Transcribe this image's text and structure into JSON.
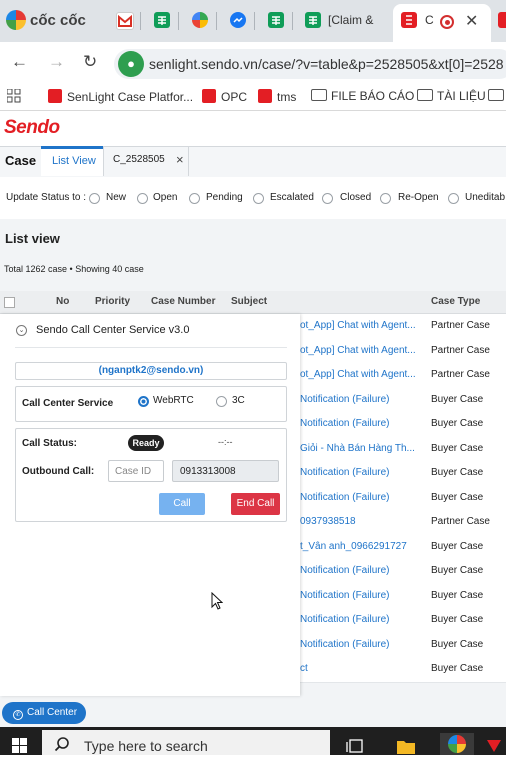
{
  "browser": {
    "brand": "cốc cốc",
    "tabs": [
      {
        "icon": "gmail-icon",
        "label": ""
      },
      {
        "icon": "sheets-icon",
        "label": ""
      },
      {
        "icon": "app-icon",
        "label": ""
      },
      {
        "icon": "messenger-icon",
        "label": ""
      },
      {
        "icon": "sheets-icon",
        "label": ""
      },
      {
        "icon": "sheets-icon",
        "label": "[Claim &"
      },
      {
        "icon": "sendo-icon",
        "label": "C",
        "active": true
      }
    ],
    "url": "senlight.sendo.vn/case/?v=table&p=2528505&xt[0]=2528",
    "bookmarks": [
      "SenLight Case Platfor...",
      "OPC",
      "tms",
      "FILE BÁO CÁO",
      "TÀI LIỆU"
    ]
  },
  "app": {
    "logo": "Sendo",
    "tabs": {
      "case": "Case",
      "list_view": "List View",
      "case_tab": "C_2528505"
    },
    "status_label": "Update Status to :",
    "statuses": [
      "New",
      "Open",
      "Pending",
      "Escalated",
      "Closed",
      "Re-Open",
      "Uneditab"
    ],
    "list_title": "List view",
    "total": "Total 1262 case • Showing 40 case",
    "columns": {
      "no": "No",
      "priority": "Priority",
      "case_number": "Case Number",
      "subject": "Subject",
      "case_type": "Case Type"
    },
    "rows": [
      {
        "subject": "ot_App] Chat with Agent...",
        "case_type": "Partner Case"
      },
      {
        "subject": "ot_App] Chat with Agent...",
        "case_type": "Partner Case"
      },
      {
        "subject": "ot_App] Chat with Agent...",
        "case_type": "Partner Case"
      },
      {
        "subject": "Notification (Failure)",
        "case_type": "Buyer Case"
      },
      {
        "subject": "Notification (Failure)",
        "case_type": "Buyer Case"
      },
      {
        "subject": "Giỏi - Nhà Bán Hàng Th...",
        "case_type": "Buyer Case"
      },
      {
        "subject": "Notification (Failure)",
        "case_type": "Buyer Case"
      },
      {
        "subject": "Notification (Failure)",
        "case_type": "Buyer Case"
      },
      {
        "subject": "0937938518",
        "case_type": "Partner Case"
      },
      {
        "subject": "t_Vân anh_0966291727",
        "case_type": "Buyer Case"
      },
      {
        "subject": "Notification (Failure)",
        "case_type": "Buyer Case"
      },
      {
        "subject": "Notification (Failure)",
        "case_type": "Buyer Case"
      },
      {
        "subject": "Notification (Failure)",
        "case_type": "Buyer Case"
      },
      {
        "subject": "Notification (Failure)",
        "case_type": "Buyer Case"
      },
      {
        "subject": "ct",
        "case_type": "Buyer Case"
      }
    ]
  },
  "call_center": {
    "title": "Sendo Call Center Service v3.0",
    "email": "(nganptk2@sendo.vn)",
    "service_label": "Call Center Service",
    "options": [
      "WebRTC",
      "3C"
    ],
    "selected": "WebRTC",
    "call_status_label": "Call Status:",
    "status": "Ready",
    "timer": "--:--",
    "outbound_label": "Outbound Call:",
    "case_id_placeholder": "Case ID",
    "phone": "0913313008",
    "call_button": "Call",
    "end_button": "End Call",
    "fab": "Call Center"
  },
  "taskbar": {
    "search_placeholder": "Type here to search"
  }
}
